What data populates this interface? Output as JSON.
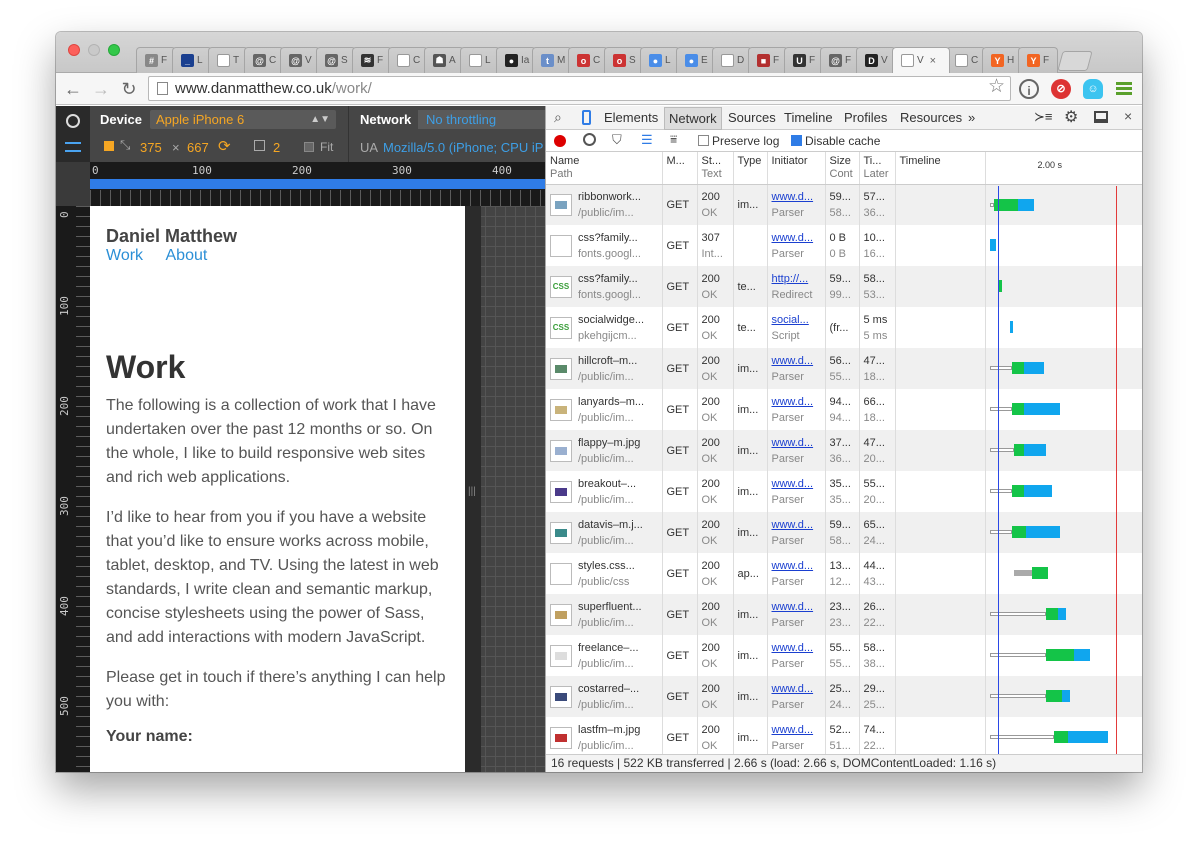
{
  "browser": {
    "tabs": [
      {
        "label": "F",
        "fav_color": "#888888",
        "fav_char": "#"
      },
      {
        "label": "L",
        "fav_color": "#1a3f8f",
        "fav_char": "_"
      },
      {
        "label": "T",
        "fav_color": "#ffffff",
        "fav_char": ""
      },
      {
        "label": "C",
        "fav_color": "#666666",
        "fav_char": "@"
      },
      {
        "label": "V",
        "fav_color": "#666666",
        "fav_char": "@"
      },
      {
        "label": "S",
        "fav_color": "#666666",
        "fav_char": "@"
      },
      {
        "label": "F",
        "fav_color": "#333333",
        "fav_char": "≋"
      },
      {
        "label": "C",
        "fav_color": "#ffffff",
        "fav_char": ""
      },
      {
        "label": "A",
        "fav_color": "#555555",
        "fav_char": "☗"
      },
      {
        "label": "L",
        "fav_color": "#ffffff",
        "fav_char": ""
      },
      {
        "label": "Ia",
        "fav_color": "#222222",
        "fav_char": "●"
      },
      {
        "label": "M",
        "fav_color": "#6b8fc9",
        "fav_char": "t"
      },
      {
        "label": "C",
        "fav_color": "#cc3333",
        "fav_char": "o"
      },
      {
        "label": "S",
        "fav_color": "#cc3333",
        "fav_char": "o"
      },
      {
        "label": "L",
        "fav_color": "#4a8de8",
        "fav_char": "●"
      },
      {
        "label": "E",
        "fav_color": "#4a8de8",
        "fav_char": "●"
      },
      {
        "label": "D",
        "fav_color": "#ffffff",
        "fav_char": ""
      },
      {
        "label": "F",
        "fav_color": "#b33030",
        "fav_char": "■"
      },
      {
        "label": "F",
        "fav_color": "#333333",
        "fav_char": "U"
      },
      {
        "label": "F",
        "fav_color": "#666666",
        "fav_char": "@"
      },
      {
        "label": "V",
        "fav_color": "#222222",
        "fav_char": "D"
      },
      {
        "label": "V",
        "fav_color": "#ffffff",
        "fav_char": "",
        "active": true
      },
      {
        "label": "C",
        "fav_color": "#ffffff",
        "fav_char": ""
      },
      {
        "label": "H",
        "fav_color": "#f26522",
        "fav_char": "Y"
      },
      {
        "label": "F",
        "fav_color": "#f26522",
        "fav_char": "Y"
      }
    ],
    "url_host": "www.danmatthew.co.uk",
    "url_path": "/work/",
    "ext_badges": [
      "0",
      "0"
    ]
  },
  "emulation": {
    "device_label": "Device",
    "device_value": "Apple iPhone 6",
    "network_label": "Network",
    "network_value": "No throttling",
    "width": "375",
    "height": "667",
    "dpr": "2",
    "fit_label": "Fit",
    "ua_label": "UA",
    "ua_value": "Mozilla/5.0 (iPhone; CPU iP",
    "ruler_top": [
      "0",
      "100",
      "200",
      "300",
      "400"
    ],
    "ruler_left": [
      "0",
      "100",
      "200",
      "300",
      "400",
      "500"
    ]
  },
  "site": {
    "title": "Daniel Matthew",
    "nav": [
      "Work",
      "About"
    ],
    "heading": "Work",
    "paragraphs": [
      "The following is a collection of work that I have undertaken over the past 12 months or so. On the whole, I like to build responsive web sites and rich web applications.",
      "I’d like to hear from you if you have a website that you’d like to ensure works across mobile, tablet, desktop, and TV. Using the latest in web standards, I write clean and semantic markup, concise stylesheets using the power of Sass, and add interactions with modern JavaScript.",
      "Please get in touch if there’s anything I can help you with:"
    ],
    "form_label": "Your name:"
  },
  "devtools": {
    "tabs": [
      "Elements",
      "Network",
      "Sources",
      "Timeline",
      "Profiles",
      "Resources"
    ],
    "more": "»",
    "preserve_log": "Preserve log",
    "disable_cache": "Disable cache",
    "columns": [
      {
        "top": "Name",
        "sub": "Path"
      },
      {
        "top": "M...",
        "sub": ""
      },
      {
        "top": "St...",
        "sub": "Text"
      },
      {
        "top": "Type",
        "sub": ""
      },
      {
        "top": "Initiator",
        "sub": ""
      },
      {
        "top": "Size",
        "sub": "Cont"
      },
      {
        "top": "Ti...",
        "sub": "Later"
      },
      {
        "top": "Timeline",
        "sub": ""
      }
    ],
    "timeline_tick": "2.00 s",
    "rows": [
      {
        "name": "ribbonwork...",
        "path": "/public/im...",
        "method": "GET",
        "status": "200",
        "text": "OK",
        "type": "im...",
        "init": "www.d...",
        "init2": "Parser",
        "size": "59...",
        "size2": "58...",
        "time": "57...",
        "time2": "36...",
        "thumb": "#7aa3c0"
      },
      {
        "name": "css?family...",
        "path": "fonts.googl...",
        "method": "GET",
        "status": "307",
        "text": "Int...",
        "type": "",
        "init": "www.d...",
        "init2": "Parser",
        "size": "0 B",
        "size2": "0 B",
        "time": "10...",
        "time2": "16...",
        "thumb": ""
      },
      {
        "name": "css?family...",
        "path": "fonts.googl...",
        "method": "GET",
        "status": "200",
        "text": "OK",
        "type": "te...",
        "init": "http://...",
        "init2": "Redirect",
        "size": "59...",
        "size2": "99...",
        "time": "58...",
        "time2": "53...",
        "thumb": "css"
      },
      {
        "name": "socialwidge...",
        "path": "pkehgijcm...",
        "method": "GET",
        "status": "200",
        "text": "OK",
        "type": "te...",
        "init": "social...",
        "init2": "Script",
        "size": "(fr...",
        "size2": "",
        "time": "5 ms",
        "time2": "5 ms",
        "thumb": "css"
      },
      {
        "name": "hillcroft–m...",
        "path": "/public/im...",
        "method": "GET",
        "status": "200",
        "text": "OK",
        "type": "im...",
        "init": "www.d...",
        "init2": "Parser",
        "size": "56...",
        "size2": "55...",
        "time": "47...",
        "time2": "18...",
        "thumb": "#5a8a6a"
      },
      {
        "name": "lanyards–m...",
        "path": "/public/im...",
        "method": "GET",
        "status": "200",
        "text": "OK",
        "type": "im...",
        "init": "www.d...",
        "init2": "Parser",
        "size": "94...",
        "size2": "94...",
        "time": "66...",
        "time2": "18...",
        "thumb": "#c9b37a"
      },
      {
        "name": "flappy–m.jpg",
        "path": "/public/im...",
        "method": "GET",
        "status": "200",
        "text": "OK",
        "type": "im...",
        "init": "www.d...",
        "init2": "Parser",
        "size": "37...",
        "size2": "36...",
        "time": "47...",
        "time2": "20...",
        "thumb": "#9ab0d0"
      },
      {
        "name": "breakout–...",
        "path": "/public/im...",
        "method": "GET",
        "status": "200",
        "text": "OK",
        "type": "im...",
        "init": "www.d...",
        "init2": "Parser",
        "size": "35...",
        "size2": "35...",
        "time": "55...",
        "time2": "20...",
        "thumb": "#4a3a8a"
      },
      {
        "name": "datavis–m.j...",
        "path": "/public/im...",
        "method": "GET",
        "status": "200",
        "text": "OK",
        "type": "im...",
        "init": "www.d...",
        "init2": "Parser",
        "size": "59...",
        "size2": "58...",
        "time": "65...",
        "time2": "24...",
        "thumb": "#3a8a8a"
      },
      {
        "name": "styles.css...",
        "path": "/public/css",
        "method": "GET",
        "status": "200",
        "text": "OK",
        "type": "ap...",
        "init": "www.d...",
        "init2": "Parser",
        "size": "13...",
        "size2": "12...",
        "time": "44...",
        "time2": "43...",
        "thumb": ""
      },
      {
        "name": "superfluent...",
        "path": "/public/im...",
        "method": "GET",
        "status": "200",
        "text": "OK",
        "type": "im...",
        "init": "www.d...",
        "init2": "Parser",
        "size": "23...",
        "size2": "23...",
        "time": "26...",
        "time2": "22...",
        "thumb": "#c0a060"
      },
      {
        "name": "freelance–...",
        "path": "/public/im...",
        "method": "GET",
        "status": "200",
        "text": "OK",
        "type": "im...",
        "init": "www.d...",
        "init2": "Parser",
        "size": "55...",
        "size2": "55...",
        "time": "58...",
        "time2": "38...",
        "thumb": "#dddddd"
      },
      {
        "name": "costarred–...",
        "path": "/public/im...",
        "method": "GET",
        "status": "200",
        "text": "OK",
        "type": "im...",
        "init": "www.d...",
        "init2": "Parser",
        "size": "25...",
        "size2": "24...",
        "time": "29...",
        "time2": "25...",
        "thumb": "#3a4a7a"
      },
      {
        "name": "lastfm–m.jpg",
        "path": "/public/im...",
        "method": "GET",
        "status": "200",
        "text": "OK",
        "type": "im...",
        "init": "www.d...",
        "init2": "Parser",
        "size": "52...",
        "size2": "51...",
        "time": "74...",
        "time2": "22...",
        "thumb": "#c03030"
      }
    ],
    "status_text": "16 requests | 522 KB transferred | 2.66 s (load: 2.66 s, DOMContentLoaded: 1.16 s)"
  },
  "colors": {
    "accent_orange": "#f5a623",
    "accent_blue": "#2f7ce6",
    "link_blue": "#2b8fd6",
    "bar_green": "#14c448",
    "bar_blue": "#10a6ee"
  }
}
